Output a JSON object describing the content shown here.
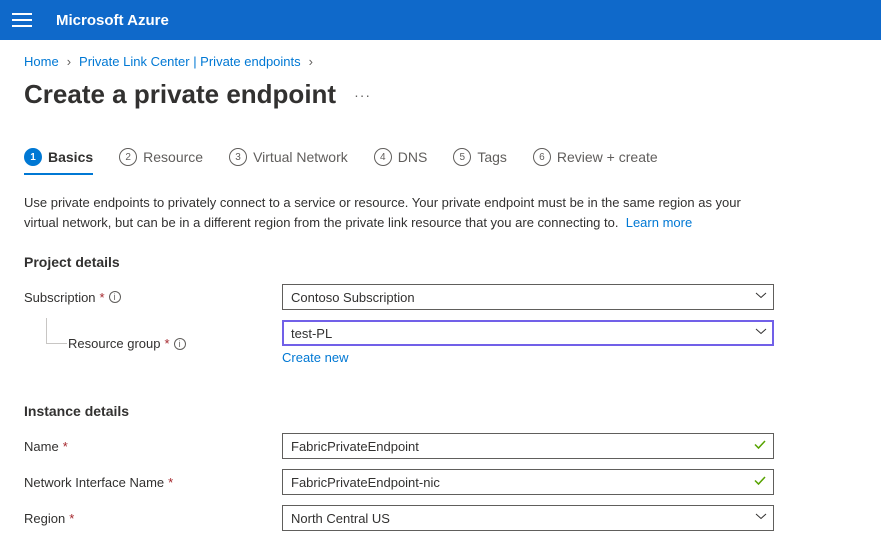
{
  "header": {
    "brand": "Microsoft Azure"
  },
  "breadcrumb": {
    "home": "Home",
    "plc": "Private Link Center | Private endpoints"
  },
  "title": "Create a private endpoint",
  "tabs": [
    {
      "num": "1",
      "label": "Basics",
      "active": true
    },
    {
      "num": "2",
      "label": "Resource"
    },
    {
      "num": "3",
      "label": "Virtual Network"
    },
    {
      "num": "4",
      "label": "DNS"
    },
    {
      "num": "5",
      "label": "Tags"
    },
    {
      "num": "6",
      "label": "Review + create"
    }
  ],
  "intro": {
    "text": "Use private endpoints to privately connect to a service or resource. Your private endpoint must be in the same region as your virtual network, but can be in a different region from the private link resource that you are connecting to.",
    "learn_more": "Learn more"
  },
  "sections": {
    "project": {
      "title": "Project details",
      "subscription_label": "Subscription",
      "subscription_value": "Contoso Subscription",
      "rg_label": "Resource group",
      "rg_value": "test-PL",
      "create_new": "Create new"
    },
    "instance": {
      "title": "Instance details",
      "name_label": "Name",
      "name_value": "FabricPrivateEndpoint",
      "nic_label": "Network Interface Name",
      "nic_value": "FabricPrivateEndpoint-nic",
      "region_label": "Region",
      "region_value": "North Central US"
    }
  }
}
